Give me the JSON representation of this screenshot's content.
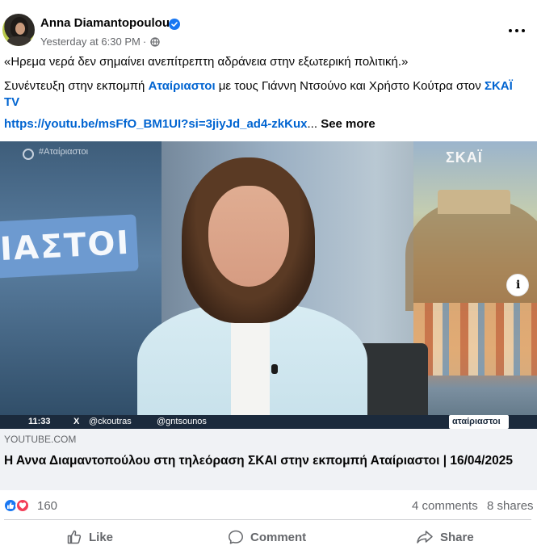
{
  "post": {
    "author": "Anna Diamantopoulou",
    "timestamp": "Yesterday at 6:30 PM",
    "separator": "·",
    "text": {
      "line1": "«Ηρεμα νερά δεν σημαίνει ανεπίτρεπτη αδράνεια στην εξωτερική πολιτική.»",
      "line2_part1": "Συνέντευξη στην εκπομπή ",
      "line2_link1": "Αταίριαστοι",
      "line2_part2": " με τους Γιάννη Ντσούνο και Χρήστο Κούτρα στον ",
      "line2_link2": "ΣΚΑΪ TV",
      "url": "https://youtu.be/msFfO_BM1UI?si=3jiyJd_ad4-zkKux",
      "ellipsis": "...",
      "see_more": "See more"
    }
  },
  "media": {
    "channel_logo": "ΣΚΑΪ",
    "screen_tag": "#Αταίριαστοι",
    "studio_banner": "ΙΑΣΤΟΙ",
    "ticker": {
      "time": "11:33",
      "x_icon": "X",
      "handle1": "@ckoutras",
      "handle2": "@gntsounos",
      "brand": "αταίριαστοι"
    },
    "info_icon": "i"
  },
  "link_preview": {
    "domain": "YOUTUBE.COM",
    "title": "Η Αννα Διαμαντοπούλου στη τηλεόραση ΣΚΑΙ στην εκπομπή Αταίριαστοι | 16/04/2025"
  },
  "stats": {
    "reactions": "160",
    "comments": "4 comments",
    "shares": "8 shares"
  },
  "actions": {
    "like": "Like",
    "comment": "Comment",
    "share": "Share"
  },
  "colors": {
    "link": "#0064d1",
    "facebook_blue": "#1877f2",
    "love_red": "#f33e58",
    "muted_text": "#65676b",
    "preview_bg": "#f0f2f5"
  }
}
